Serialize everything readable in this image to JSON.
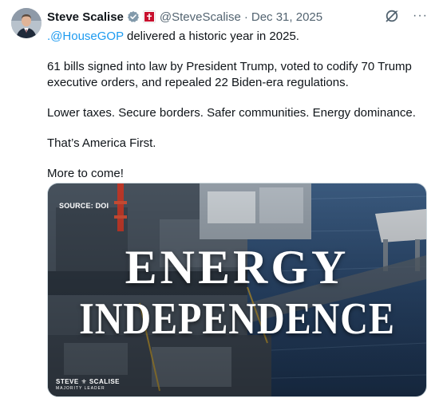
{
  "post": {
    "author_name": "Steve Scalise",
    "handle": "@SteveScalise",
    "separator": "·",
    "date": "Dec 31, 2025",
    "more_label": "···",
    "paragraph_1_mention": ".@HouseGOP",
    "paragraph_1_rest": " delivered a historic year in 2025.",
    "paragraph_2": "61 bills signed into law by President Trump, voted to codify 70 Trump executive orders, and repealed 22 Biden-era regulations.",
    "paragraph_3": "Lower taxes. Secure borders. Safer communities. Energy dominance.",
    "paragraph_4": "That’s America First.",
    "paragraph_5": "More to come!"
  },
  "media": {
    "source_label": "SOURCE: DOI",
    "headline_line_1": "ENERGY",
    "headline_line_2": "INDEPENDENCE",
    "logo_line_1": "STEVE ⚜ SCALISE",
    "logo_line_2": "MAJORITY LEADER"
  },
  "colors": {
    "link": "#1d9bf0",
    "verified_badge": "#829aab",
    "text": "#0f1419",
    "secondary_text": "#536471"
  },
  "icons": {
    "verified": "verified-badge-icon",
    "affiliation": "us-capitol-flag-icon",
    "grok": "grok-icon",
    "more": "more-icon"
  }
}
